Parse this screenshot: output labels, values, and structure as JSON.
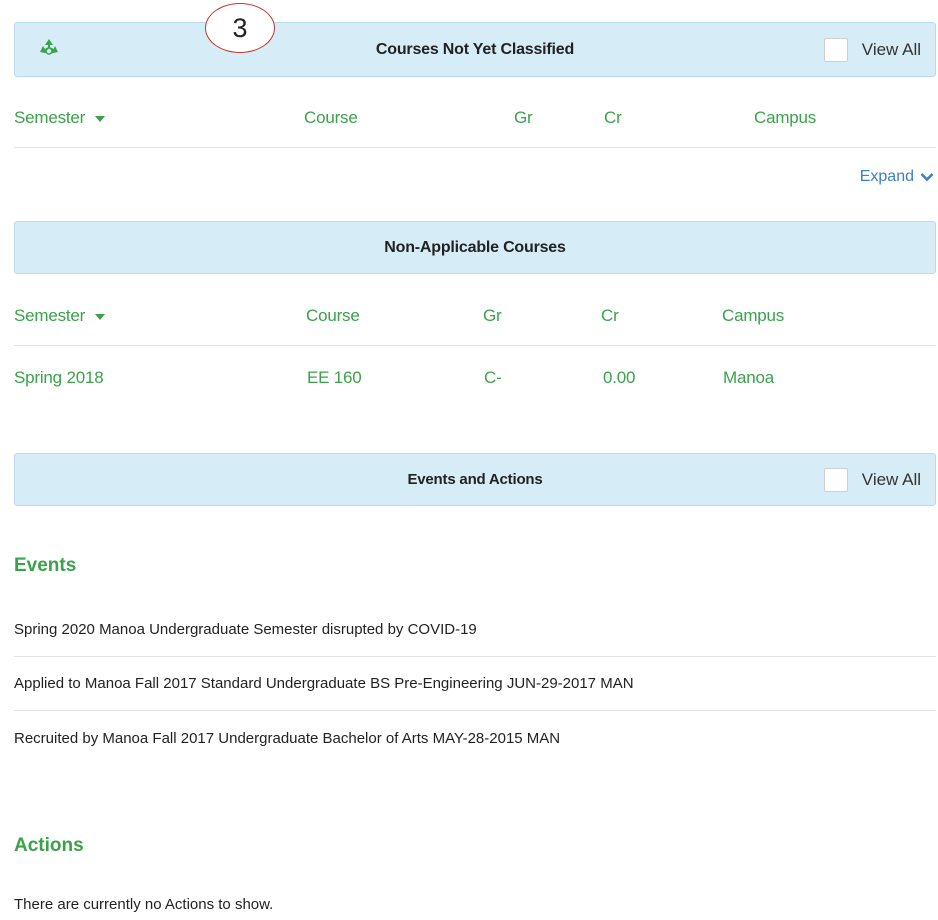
{
  "step_marker": "3",
  "not_classified": {
    "title": "Courses Not Yet Classified",
    "view_all": "View All",
    "columns": {
      "semester": "Semester",
      "course": "Course",
      "gr": "Gr",
      "cr": "Cr",
      "campus": "Campus"
    },
    "expand": "Expand"
  },
  "non_applicable": {
    "title": "Non-Applicable Courses",
    "columns": {
      "semester": "Semester",
      "course": "Course",
      "gr": "Gr",
      "cr": "Cr",
      "campus": "Campus"
    },
    "rows": [
      {
        "semester": "Spring 2018",
        "course": "EE 160",
        "gr": "C-",
        "cr": "0.00",
        "campus": "Manoa"
      }
    ]
  },
  "events_actions": {
    "title": "Events and Actions",
    "view_all": "View All"
  },
  "events": {
    "heading": "Events",
    "items": [
      "Spring 2020 Manoa Undergraduate Semester disrupted by COVID-19",
      "Applied to Manoa Fall 2017 Standard Undergraduate BS Pre-Engineering JUN-29-2017 MAN",
      "Recruited by Manoa Fall 2017 Undergraduate Bachelor of Arts MAY-28-2015 MAN"
    ]
  },
  "actions": {
    "heading": "Actions",
    "empty_text": "There are currently no Actions to show."
  },
  "colors": {
    "accent_green": "#3aa24a",
    "link_blue": "#3b80c3",
    "panel_blue": "#d6edf8"
  },
  "icons": {
    "recycle": "recycle-icon",
    "expand": "chevron-down-icon"
  }
}
